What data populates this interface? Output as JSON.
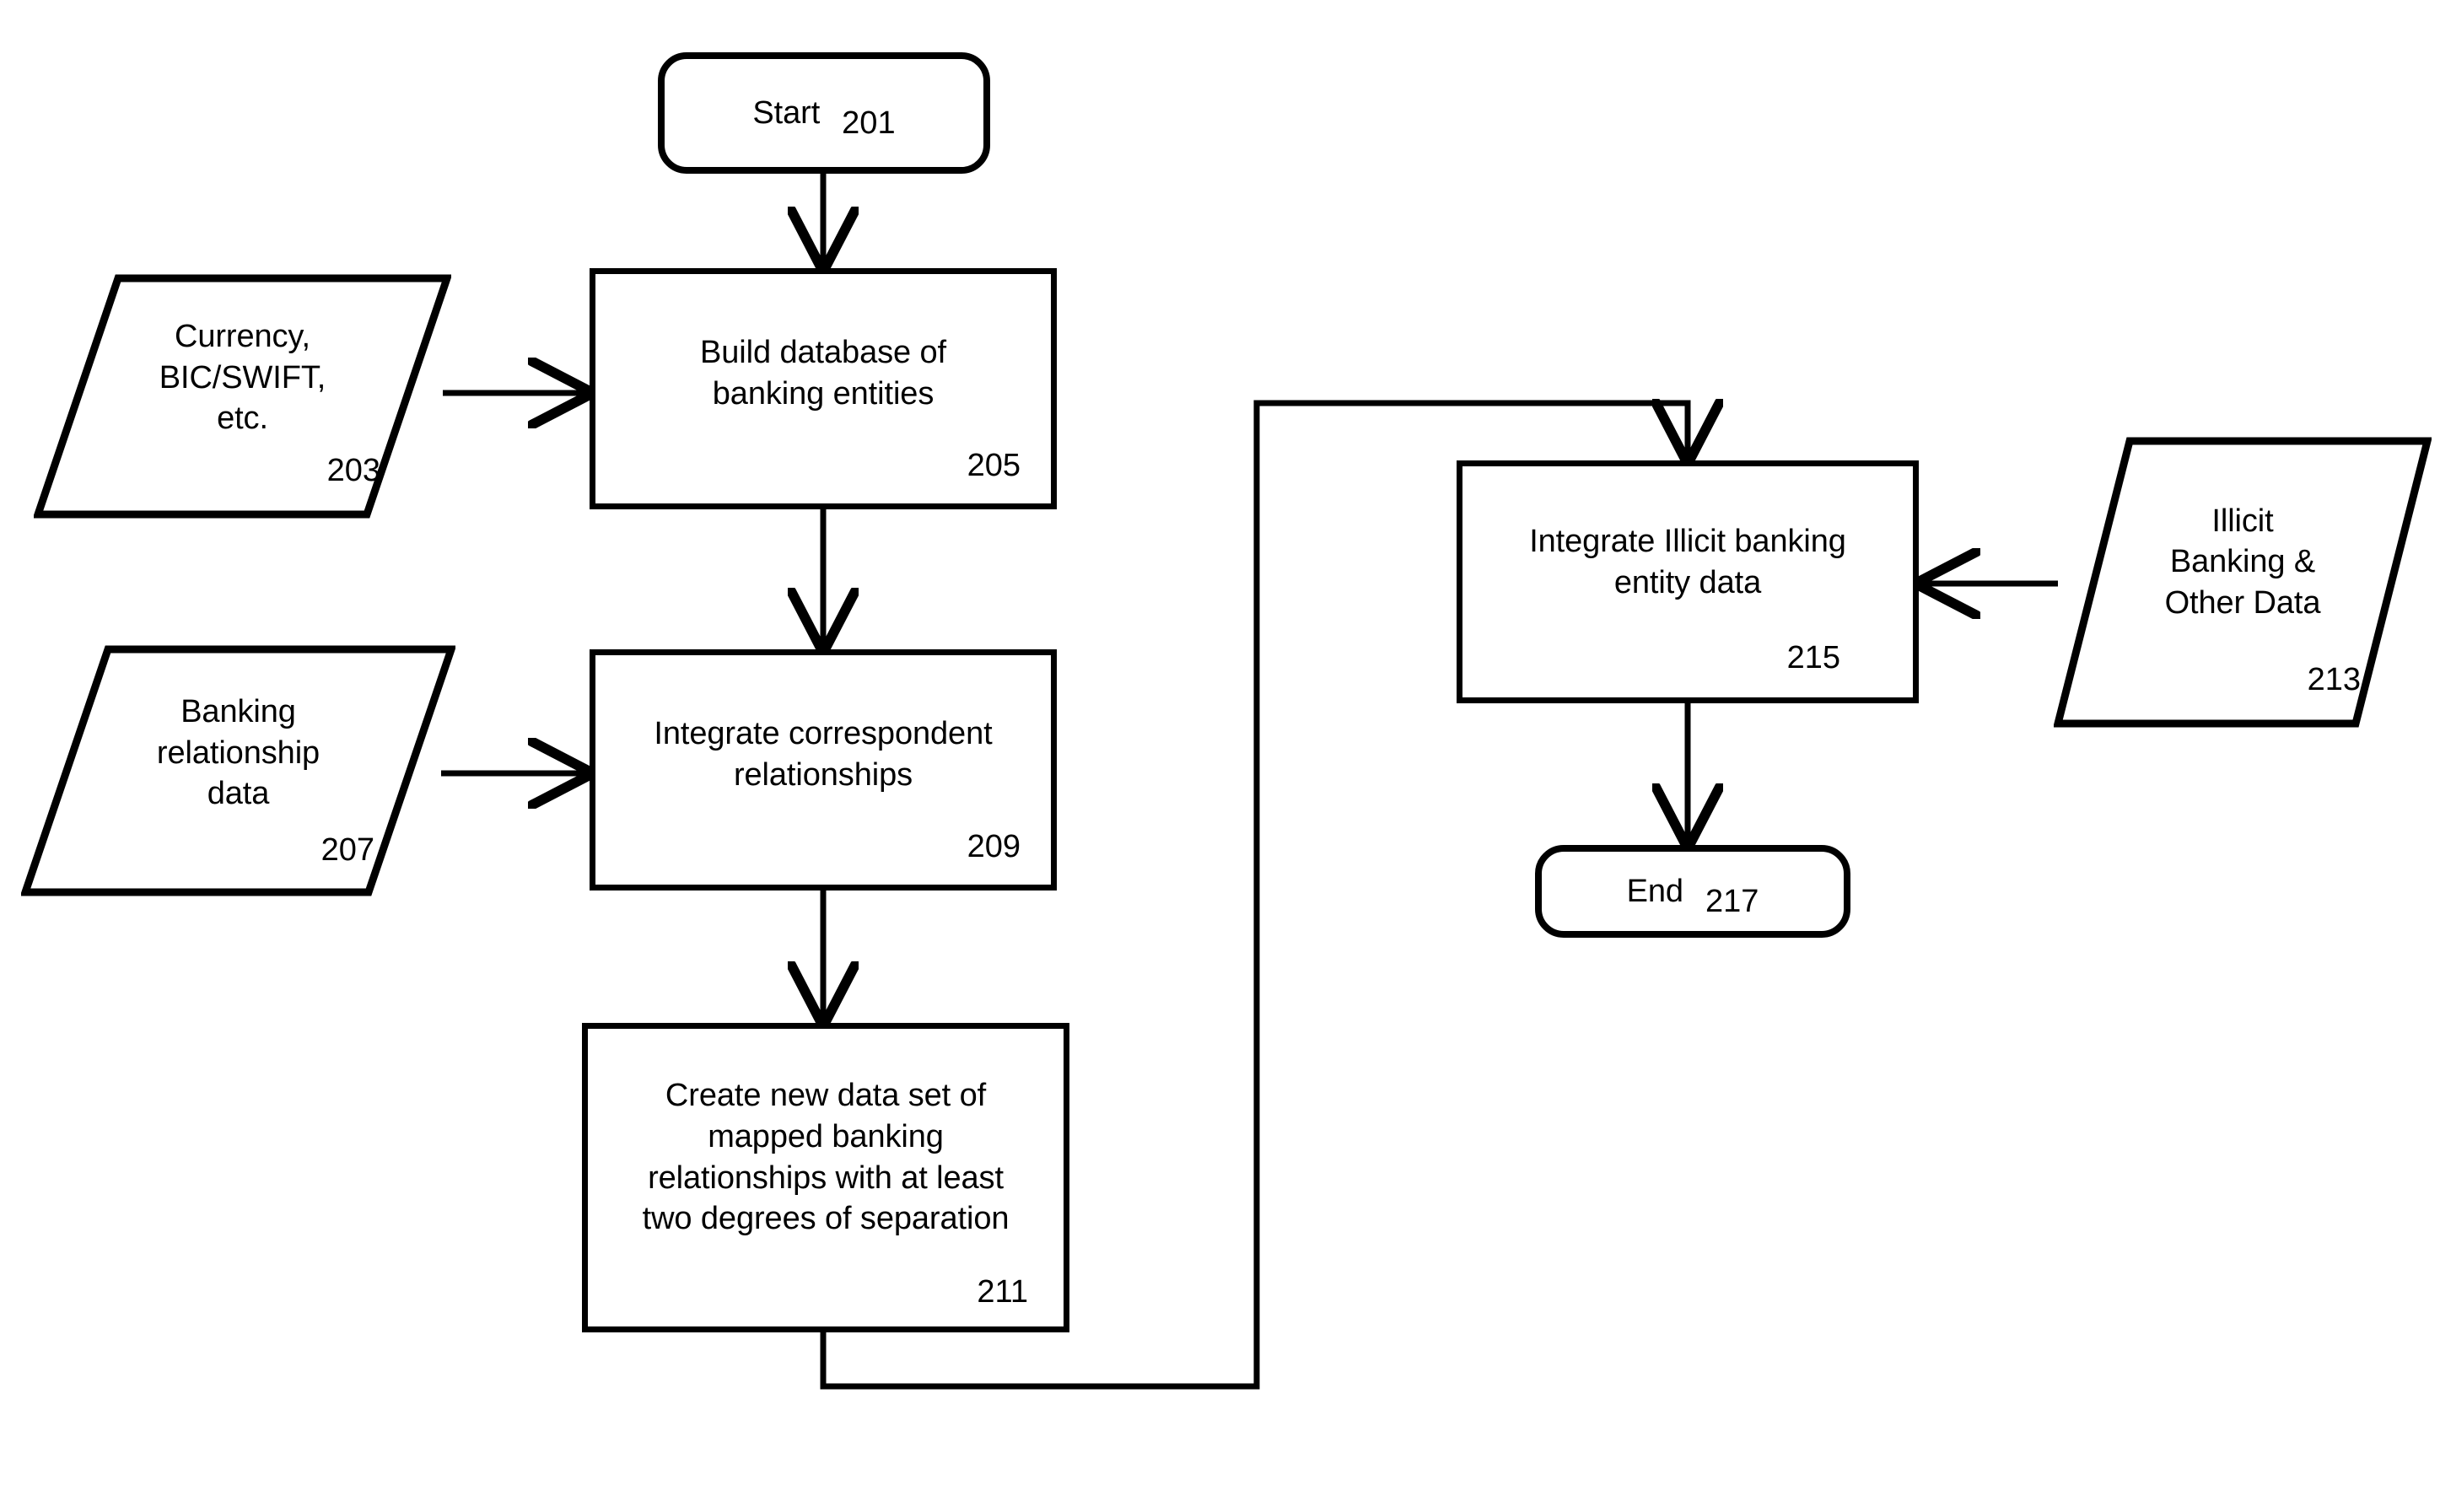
{
  "diagram": {
    "title": "Banking entity relationship mapping process flowchart",
    "stroke_color": "#000000",
    "background_color": "#ffffff"
  },
  "nodes": [
    {
      "id": "start",
      "shape": "terminator",
      "label": "Start",
      "ref": "201"
    },
    {
      "id": "currency_input",
      "shape": "data",
      "label": "Currency,\nBIC/SWIFT,\netc.",
      "ref": "203"
    },
    {
      "id": "build_db",
      "shape": "process",
      "label": "Build database of\nbanking entities",
      "ref": "205"
    },
    {
      "id": "banking_relationship_input",
      "shape": "data",
      "label": "Banking\nrelationship\ndata",
      "ref": "207"
    },
    {
      "id": "integrate_correspondent",
      "shape": "process",
      "label": "Integrate correspondent\nrelationships",
      "ref": "209"
    },
    {
      "id": "create_data_set",
      "shape": "process",
      "label": "Create new data set of\nmapped banking\nrelationships with at least\ntwo degrees of separation",
      "ref": "211"
    },
    {
      "id": "illicit_input",
      "shape": "data",
      "label": "Illicit\nBanking &\nOther Data",
      "ref": "213"
    },
    {
      "id": "integrate_illicit",
      "shape": "process",
      "label": "Integrate Illicit banking\nentity data",
      "ref": "215"
    },
    {
      "id": "end",
      "shape": "terminator",
      "label": "End",
      "ref": "217"
    }
  ],
  "edges": [
    {
      "from": "start",
      "to": "build_db",
      "type": "straight-down",
      "arrow": true
    },
    {
      "from": "currency_input",
      "to": "build_db",
      "type": "straight-right",
      "arrow": true
    },
    {
      "from": "build_db",
      "to": "integrate_correspondent",
      "type": "straight-down",
      "arrow": true
    },
    {
      "from": "banking_relationship_input",
      "to": "integrate_correspondent",
      "type": "straight-right",
      "arrow": true
    },
    {
      "from": "integrate_correspondent",
      "to": "create_data_set",
      "type": "straight-down",
      "arrow": true
    },
    {
      "from": "create_data_set",
      "to": "integrate_illicit",
      "type": "elbow-around-right",
      "arrow": true
    },
    {
      "from": "illicit_input",
      "to": "integrate_illicit",
      "type": "straight-left",
      "arrow": true
    },
    {
      "from": "integrate_illicit",
      "to": "end",
      "type": "straight-down",
      "arrow": true
    }
  ]
}
